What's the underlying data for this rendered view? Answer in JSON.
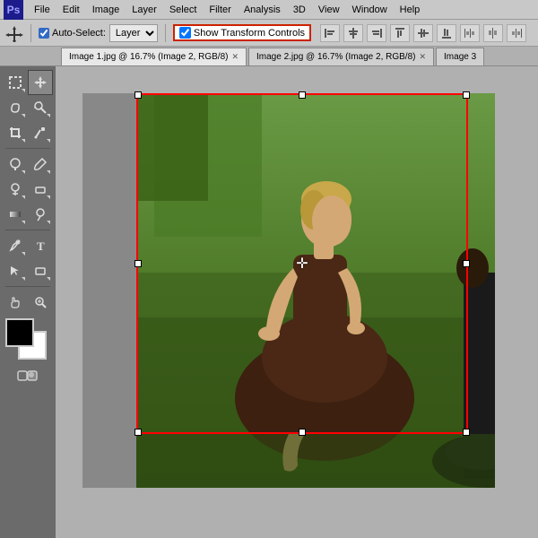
{
  "app": {
    "logo": "Ps",
    "logo_color": "#1c1c8c"
  },
  "menubar": {
    "items": [
      "File",
      "Edit",
      "Image",
      "Layer",
      "Select",
      "Filter",
      "Analysis",
      "3D",
      "View",
      "Window",
      "Help"
    ]
  },
  "options_bar": {
    "move_tool_label": "↔",
    "auto_select_checked": true,
    "auto_select_label": "Auto-Select:",
    "layer_dropdown": "Layer",
    "show_transform_label": "Show Transform Controls",
    "show_transform_checked": true,
    "align_buttons": [
      "⬛",
      "⬛",
      "⬛",
      "⬛",
      "⬛",
      "⬛",
      "⬛",
      "⬛",
      "⬛"
    ]
  },
  "tabs": [
    {
      "label": "Image 1.jpg @ 16.7% (Image 2, RGB/8)",
      "active": true,
      "dirty": true
    },
    {
      "label": "Image 2.jpg @ 16.7% (Image 2, RGB/8)",
      "active": false,
      "dirty": true
    },
    {
      "label": "Image 3",
      "active": false,
      "dirty": false
    }
  ],
  "toolbox": {
    "tools": [
      {
        "name": "move",
        "icon": "✛",
        "active": false
      },
      {
        "name": "move-tool",
        "icon": "↔",
        "active": true
      },
      {
        "name": "lasso",
        "icon": "⌾",
        "active": false
      },
      {
        "name": "magic-wand",
        "icon": "✦",
        "active": false
      },
      {
        "name": "crop",
        "icon": "⊞",
        "active": false
      },
      {
        "name": "eyedropper",
        "icon": "✏",
        "active": false
      },
      {
        "name": "spot-heal",
        "icon": "⊕",
        "active": false
      },
      {
        "name": "brush",
        "icon": "✏",
        "active": false
      },
      {
        "name": "clone",
        "icon": "⊙",
        "active": false
      },
      {
        "name": "eraser",
        "icon": "▭",
        "active": false
      },
      {
        "name": "gradient",
        "icon": "▤",
        "active": false
      },
      {
        "name": "dodge",
        "icon": "◑",
        "active": false
      },
      {
        "name": "pen",
        "icon": "✒",
        "active": false
      },
      {
        "name": "type",
        "icon": "T",
        "active": false
      },
      {
        "name": "path-select",
        "icon": "↗",
        "active": false
      },
      {
        "name": "shape",
        "icon": "▭",
        "active": false
      },
      {
        "name": "hand",
        "icon": "✋",
        "active": false
      },
      {
        "name": "zoom",
        "icon": "🔍",
        "active": false
      }
    ]
  },
  "canvas": {
    "zoom": "16.7%",
    "image_name": "Image 1.jpg"
  }
}
